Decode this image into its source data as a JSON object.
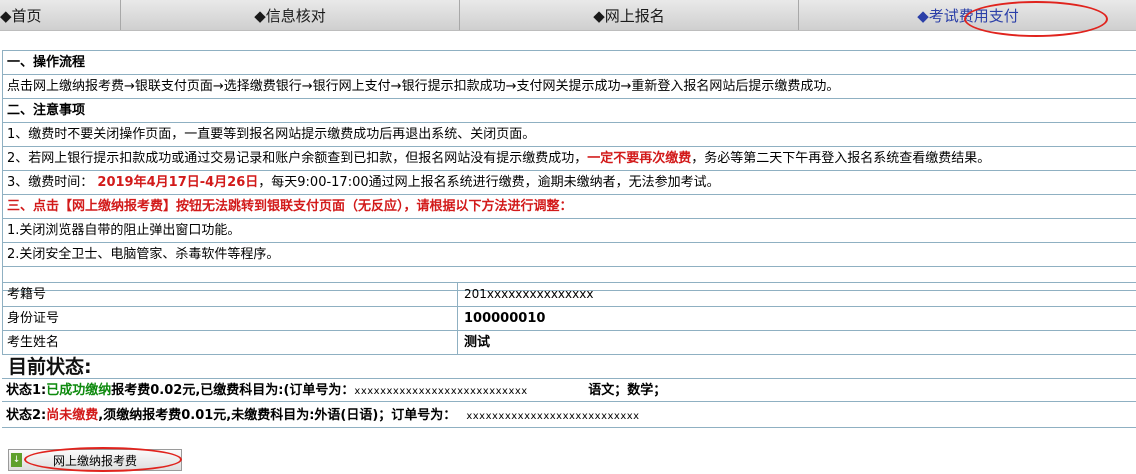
{
  "nav": {
    "items": [
      {
        "label": "◆首页"
      },
      {
        "label": "◆信息核对"
      },
      {
        "label": "◆网上报名"
      },
      {
        "label": "◆考试费用支付"
      }
    ]
  },
  "flow": {
    "heading": "一、操作流程",
    "text": "点击网上缴纳报考费→银联支付页面→选择缴费银行→银行网上支付→银行提示扣款成功→支付网关提示成功→重新登入报名网站后提示缴费成功。"
  },
  "notes": {
    "heading": "二、注意事项",
    "item1": "1、缴费时不要关闭操作页面，一直要等到报名网站提示缴费成功后再退出系统、关闭页面。",
    "item2_pre": "2、若网上银行提示扣款成功或通过交易记录和账户余额查到已扣款，但报名网站没有提示缴费成功，",
    "item2_em": "一定不要再次缴费",
    "item2_post": "，务必等第二天下午再登入报名系统查看缴费结果。",
    "item3_pre": "3、缴费时间：",
    "item3_date": "2019年4月17日-4月26日",
    "item3_post": "，每天9:00-17:00通过网上报名系统进行缴费，逾期未缴纳者，无法参加考试。"
  },
  "fix": {
    "heading": "三、点击【网上缴纳报考费】按钮无法跳转到银联支付页面（无反应），请根据以下方法进行调整：",
    "item1": "1.关闭浏览器自带的阻止弹出窗口功能。",
    "item2": "2.关闭安全卫士、电脑管家、杀毒软件等程序。"
  },
  "candidate": {
    "exam_no_label": "考籍号",
    "exam_no": "201xxxxxxxxxxxxxxx",
    "id_label": "身份证号",
    "id_value": "100000010",
    "name_label": "考生姓名",
    "name_value": "测试"
  },
  "status": {
    "title": "目前状态:",
    "s1_label": "状态1:",
    "s1_status": "已成功缴纳",
    "s1_text": "报考费0.02元,已缴费科目为:(订单号为：",
    "s1_order": "xxxxxxxxxxxxxxxxxxxxxxxxxxx",
    "s1_subjects": "语文；数学；",
    "s2_label": "状态2:",
    "s2_status": "尚未缴费",
    "s2_text": ",须缴纳报考费0.01元,未缴费科目为:外语(日语)；订单号为：",
    "s2_order": "xxxxxxxxxxxxxxxxxxxxxxxxxxx"
  },
  "button": {
    "label": "网上缴纳报考费"
  }
}
